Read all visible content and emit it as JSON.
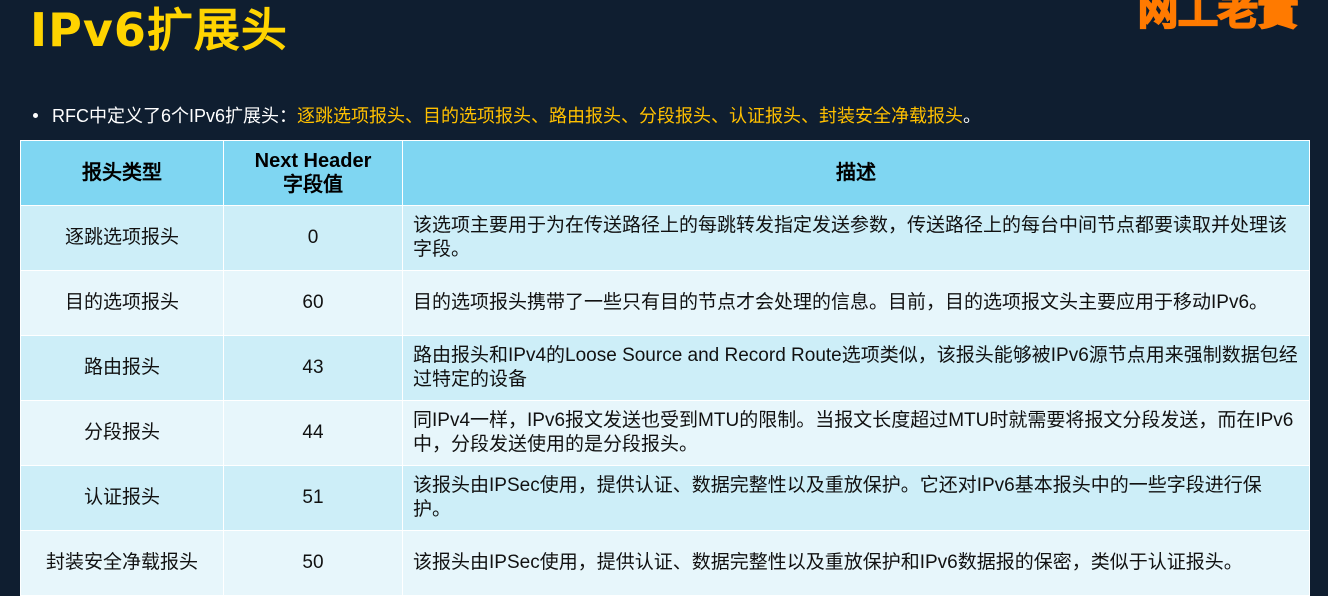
{
  "title": "IPv6扩展头",
  "corner_logo": "网工老實",
  "bullet": {
    "prefix": "RFC中定义了6个IPv6扩展头：",
    "highlight": "逐跳选项报头、目的选项报头、路由报头、分段报头、认证报头、封装安全净载报头",
    "suffix": "。"
  },
  "table": {
    "headers": {
      "type": "报头类型",
      "next_header_line1": "Next Header",
      "next_header_line2": "字段值",
      "desc": "描述"
    },
    "rows": [
      {
        "type": "逐跳选项报头",
        "value": "0",
        "desc": "该选项主要用于为在传送路径上的每跳转发指定发送参数，传送路径上的每台中间节点都要读取并处理该字段。"
      },
      {
        "type": "目的选项报头",
        "value": "60",
        "desc": "目的选项报头携带了一些只有目的节点才会处理的信息。目前，目的选项报文头主要应用于移动IPv6。"
      },
      {
        "type": "路由报头",
        "value": "43",
        "desc": "路由报头和IPv4的Loose Source and Record Route选项类似，该报头能够被IPv6源节点用来强制数据包经过特定的设备"
      },
      {
        "type": "分段报头",
        "value": "44",
        "desc": "同IPv4一样，IPv6报文发送也受到MTU的限制。当报文长度超过MTU时就需要将报文分段发送，而在IPv6中，分段发送使用的是分段报头。"
      },
      {
        "type": "认证报头",
        "value": "51",
        "desc": "该报头由IPSec使用，提供认证、数据完整性以及重放保护。它还对IPv6基本报头中的一些字段进行保护。"
      },
      {
        "type": "封装安全净载报头",
        "value": "50",
        "desc": "该报头由IPSec使用，提供认证、数据完整性以及重放保护和IPv6数据报的保密，类似于认证报头。"
      }
    ]
  },
  "colors": {
    "background": "#0f1e30",
    "title": "#ffd400",
    "highlight": "#ffc000",
    "header_bg": "#7fd6f2",
    "row_odd_bg": "#cdeef8",
    "row_even_bg": "#e7f6fb"
  }
}
